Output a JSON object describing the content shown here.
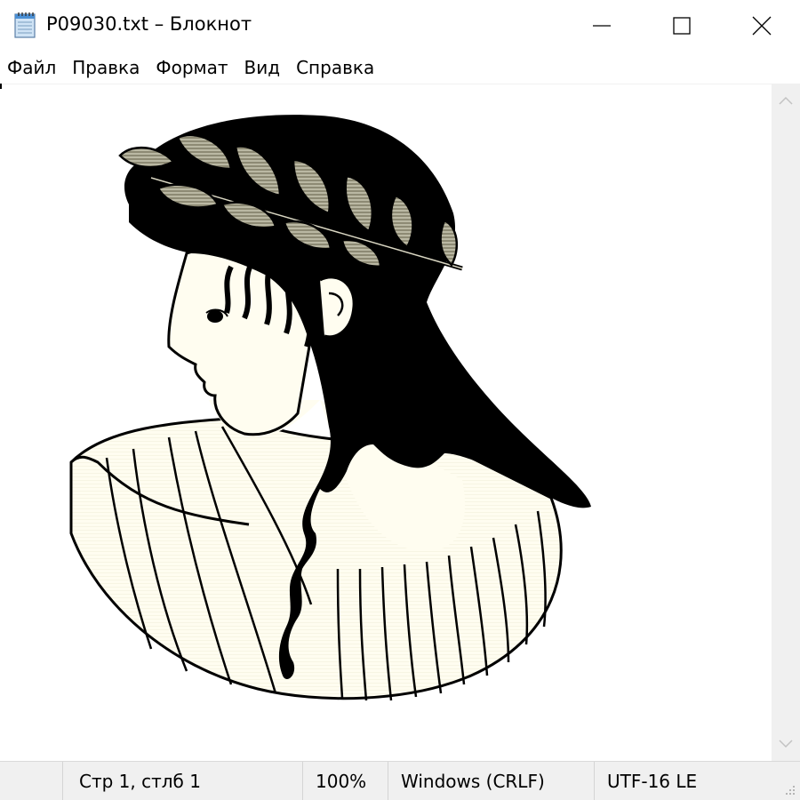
{
  "window": {
    "title": "P09030.txt – Блокнот"
  },
  "icons": {
    "app": "notepad-icon",
    "minimize": "minimize-icon",
    "maximize": "maximize-icon",
    "close": "close-icon",
    "scroll_up": "chevron-up-icon",
    "scroll_down": "chevron-down-icon"
  },
  "menu": {
    "items": [
      {
        "label": "Файл"
      },
      {
        "label": "Правка"
      },
      {
        "label": "Формат"
      },
      {
        "label": "Вид"
      },
      {
        "label": "Справка"
      }
    ]
  },
  "status": {
    "position": "Стр 1, стлб 1",
    "zoom": "100%",
    "line_endings": "Windows (CRLF)",
    "encoding": "UTF-16 LE"
  },
  "colors": {
    "skin": "#fffdf0",
    "hair": "#000000",
    "laurel": "#a8a48c"
  }
}
